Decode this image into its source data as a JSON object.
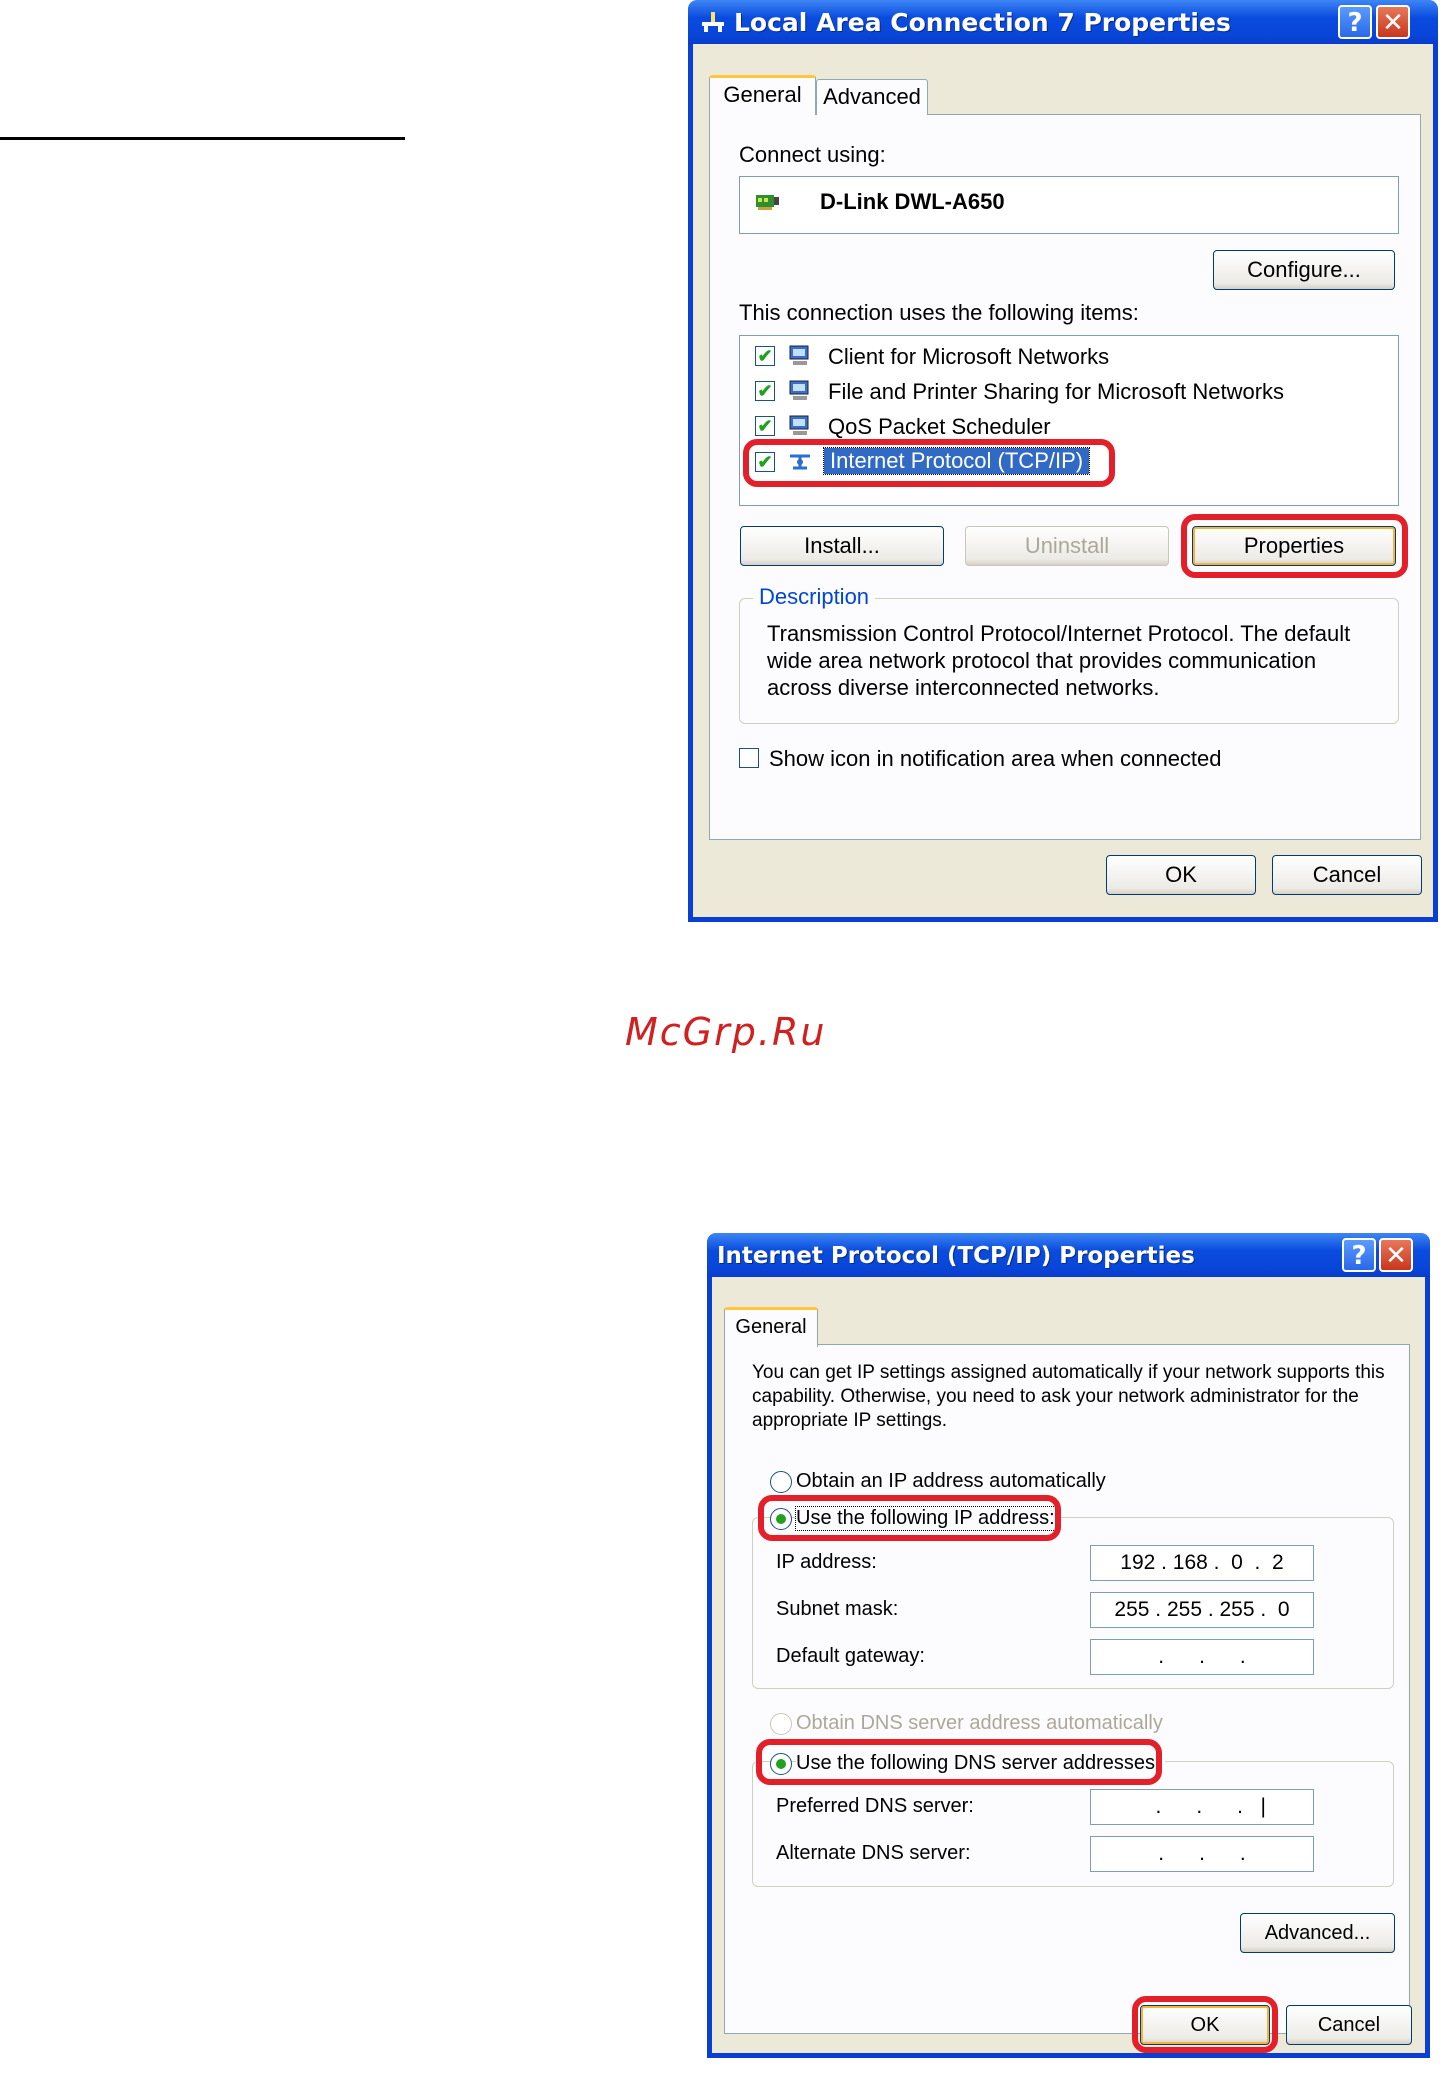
{
  "watermark": "McGrp.Ru",
  "dialog1": {
    "title": "Local Area Connection 7 Properties",
    "help_glyph": "?",
    "close_glyph": "✕",
    "tabs": [
      "General",
      "Advanced"
    ],
    "connect_using_label": "Connect using:",
    "adapter_name": "D-Link DWL-A650",
    "configure_label": "Configure...",
    "items_label": "This connection uses the following items:",
    "items": [
      {
        "label": "Client for Microsoft Networks",
        "checked": true
      },
      {
        "label": "File and Printer Sharing for Microsoft Networks",
        "checked": true
      },
      {
        "label": "QoS Packet Scheduler",
        "checked": true
      },
      {
        "label": "Internet Protocol (TCP/IP)",
        "checked": true,
        "selected": true
      }
    ],
    "install_label": "Install...",
    "uninstall_label": "Uninstall",
    "properties_label": "Properties",
    "description_title": "Description",
    "description_text": "Transmission Control Protocol/Internet Protocol. The default wide area network protocol that provides communication across diverse interconnected networks.",
    "show_icon_label": "Show icon in notification area when connected",
    "show_icon_checked": false,
    "ok_label": "OK",
    "cancel_label": "Cancel"
  },
  "dialog2": {
    "title": "Internet Protocol (TCP/IP) Properties",
    "help_glyph": "?",
    "close_glyph": "✕",
    "tab": "General",
    "intro": "You can get IP settings assigned automatically if your network supports this capability. Otherwise, you need to ask your network administrator for the appropriate IP settings.",
    "radio_auto_ip": "Obtain an IP address automatically",
    "radio_manual_ip": "Use the following IP address:",
    "ip_label": "IP address:",
    "ip_value": "192 . 168 .  0  .  2",
    "subnet_label": "Subnet mask:",
    "subnet_value": "255 . 255 . 255 .  0",
    "gateway_label": "Default gateway:",
    "gateway_value": "   .      .      .   ",
    "radio_auto_dns": "Obtain DNS server address automatically",
    "radio_manual_dns": "Use the following DNS server addresses:",
    "preferred_dns_label": "Preferred DNS server:",
    "preferred_dns_value": "   .      .      .   |",
    "alternate_dns_label": "Alternate DNS server:",
    "alternate_dns_value": "   .      .      .   ",
    "advanced_label": "Advanced...",
    "ok_label": "OK",
    "cancel_label": "Cancel"
  },
  "colors": {
    "titlebar": "#0a4bde",
    "highlight_ring": "#e3202a",
    "selection": "#316ac5",
    "radio_dot": "#21a121"
  }
}
